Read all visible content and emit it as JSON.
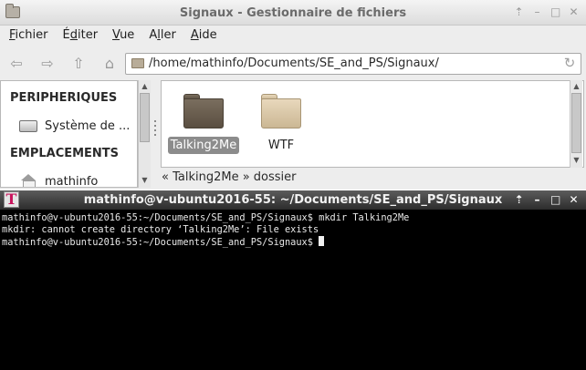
{
  "file_manager": {
    "title": "Signaux - Gestionnaire de fichiers",
    "window_buttons": [
      "⇡",
      "–",
      "□",
      "✕"
    ],
    "menu": [
      {
        "pre": "",
        "u": "F",
        "post": "ichier"
      },
      {
        "pre": "É",
        "u": "d",
        "post": "iter"
      },
      {
        "pre": "",
        "u": "V",
        "post": "ue"
      },
      {
        "pre": "A",
        "u": "l",
        "post": "ler"
      },
      {
        "pre": "",
        "u": "A",
        "post": "ide"
      }
    ],
    "toolbar": {
      "back_glyph": "⇦",
      "forward_glyph": "⇨",
      "up_glyph": "⇧",
      "home_glyph": "⌂"
    },
    "path": "/home/mathinfo/Documents/SE_and_PS/Signaux/",
    "reload_glyph": "↻",
    "sidebar": {
      "devices_heading": "PERIPHERIQUES",
      "devices_item": "Système de ...",
      "places_heading": "EMPLACEMENTS",
      "places_item": "mathinfo"
    },
    "files": [
      {
        "name": "Talking2Me",
        "selected": true
      },
      {
        "name": "WTF",
        "selected": false
      }
    ],
    "status": "« Talking2Me » dossier",
    "colors": {
      "folder_dark": "#5a4f41",
      "folder_light": "#cbb794",
      "selection": "#8c8c8c"
    }
  },
  "terminal": {
    "icon_letter": "T",
    "title": "mathinfo@v-ubuntu2016-55: ~/Documents/SE_and_PS/Signaux",
    "window_buttons": [
      "⇡",
      "–",
      "□",
      "✕"
    ],
    "lines": [
      "mathinfo@v-ubuntu2016-55:~/Documents/SE_and_PS/Signaux$ mkdir Talking2Me",
      "mkdir: cannot create directory ‘Talking2Me’: File exists",
      "mathinfo@v-ubuntu2016-55:~/Documents/SE_and_PS/Signaux$ "
    ]
  }
}
